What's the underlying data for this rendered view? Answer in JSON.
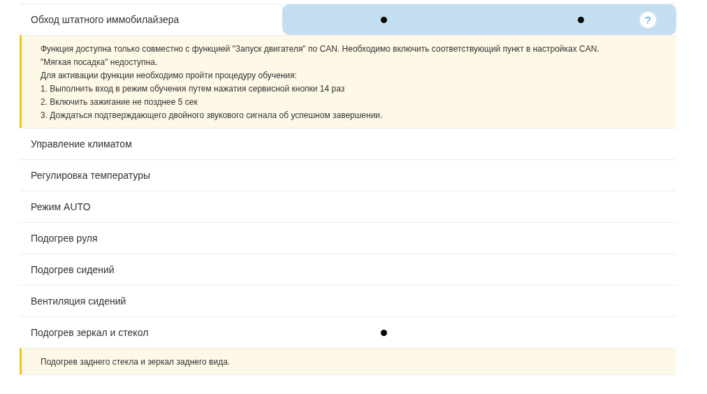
{
  "rows": [
    {
      "kind": "feature",
      "label": "Обход штатного иммобилайзера",
      "highlighted": true,
      "column_1": true,
      "column_2": true,
      "help": "?"
    },
    {
      "kind": "note",
      "lines": [
        "Функция доступна только совместно с функцией \"Запуск двигателя\" по CAN. Необходимо включить соответствующий пункт в настройках CAN.",
        "\"Мягкая посадка\" недоступна.",
        "Для активации функции необходимо пройти процедуру обучения:",
        "1. Выполнить вход в режим обучения путем нажатия сервисной кнопки 14 раз",
        "2. Включить зажигание не позднее 5 сек",
        "3. Дождаться подтверждающего двойного звукового сигнала об успешном завершении."
      ]
    },
    {
      "kind": "feature",
      "label": "Управление климатом",
      "highlighted": false,
      "column_1": false,
      "column_2": false
    },
    {
      "kind": "feature",
      "label": "Регулировка температуры",
      "highlighted": false,
      "column_1": false,
      "column_2": false
    },
    {
      "kind": "feature",
      "label": "Режим AUTO",
      "highlighted": false,
      "column_1": false,
      "column_2": false
    },
    {
      "kind": "feature",
      "label": "Подогрев руля",
      "highlighted": false,
      "column_1": false,
      "column_2": false
    },
    {
      "kind": "feature",
      "label": "Подогрев сидений",
      "highlighted": false,
      "column_1": false,
      "column_2": false
    },
    {
      "kind": "feature",
      "label": "Вентиляция сидений",
      "highlighted": false,
      "column_1": false,
      "column_2": false
    },
    {
      "kind": "feature",
      "label": "Подогрев зеркал и стекол",
      "highlighted": false,
      "column_1": true,
      "column_2": false
    },
    {
      "kind": "note",
      "lines": [
        "Подогрев заднего стекла и зеркал заднего вида."
      ]
    },
    {
      "kind": "feature",
      "highlighted": false,
      "column_1": false,
      "column_2": false
    }
  ]
}
